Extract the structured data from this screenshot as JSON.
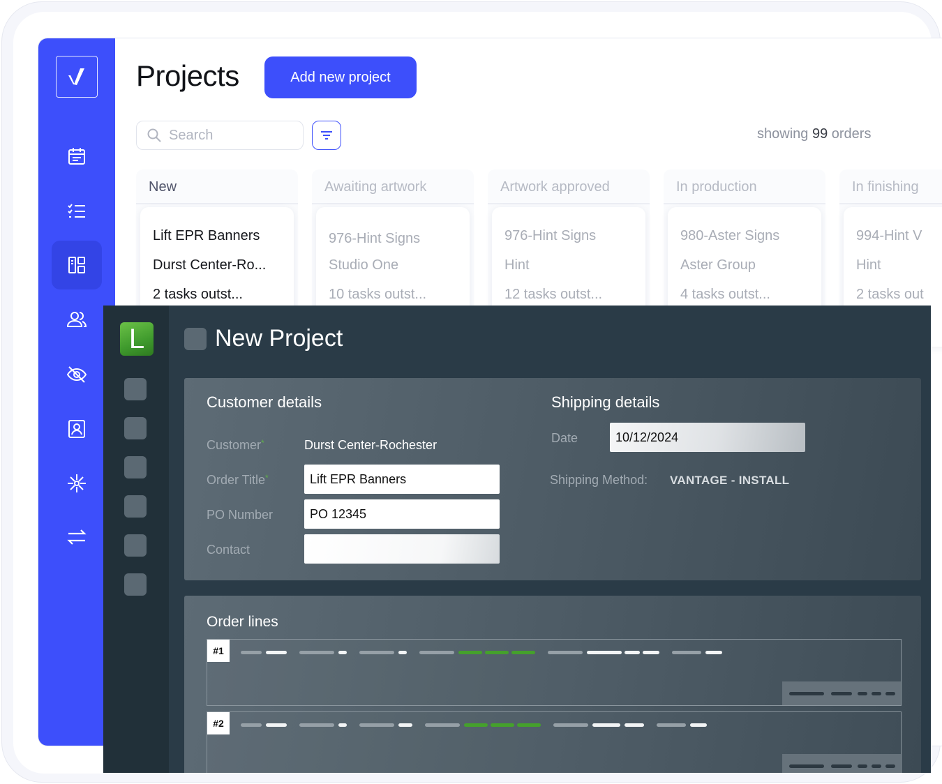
{
  "back_app": {
    "title": "Projects",
    "add_button": "Add new project",
    "search_placeholder": "Search",
    "showing_prefix": "showing",
    "showing_count": "99",
    "showing_suffix": "orders",
    "nav_icons": [
      "calendar-icon",
      "checklist-icon",
      "board-icon",
      "users-icon",
      "hidden-icon",
      "contact-card-icon",
      "snowflake-icon",
      "transfer-icon"
    ],
    "columns": [
      {
        "name": "New",
        "card": {
          "title": "Lift EPR Banners",
          "customer": "Durst Center-Ro...",
          "tasks": "2 tasks outst..."
        }
      },
      {
        "name": "Awaiting artwork",
        "card": {
          "title": "976-Hint Signs",
          "customer": "Studio One",
          "tasks": "10 tasks outst..."
        }
      },
      {
        "name": "Artwork approved",
        "card": {
          "title": "976-Hint Signs",
          "customer": "Hint",
          "tasks": "12 tasks outst..."
        }
      },
      {
        "name": "In production",
        "card": {
          "title": "980-Aster Signs",
          "customer": "Aster Group",
          "tasks": "4 tasks outst..."
        }
      },
      {
        "name": "In finishing",
        "card": {
          "title": "994-Hint V",
          "customer": "Hint",
          "tasks": "2 tasks out"
        }
      }
    ],
    "colors": {
      "brand": "#3d4ffb"
    }
  },
  "front_app": {
    "logo_letter": "L",
    "title": "New Project",
    "customer_details": {
      "heading": "Customer details",
      "customer_label": "Customer",
      "customer_value": "Durst Center-Rochester",
      "order_title_label": "Order Title",
      "order_title_value": "Lift EPR Banners",
      "po_label": "PO Number",
      "po_value": "PO 12345",
      "contact_label": "Contact",
      "contact_value": ""
    },
    "shipping_details": {
      "heading": "Shipping details",
      "date_label": "Date",
      "date_value": "10/12/2024",
      "method_label": "Shipping Method:",
      "method_value": "VANTAGE - INSTALL"
    },
    "order_lines": {
      "heading": "Order lines",
      "lines": [
        {
          "tag": "#1"
        },
        {
          "tag": "#2"
        }
      ]
    },
    "colors": {
      "accent": "#45a02c",
      "background": "#2a3b47"
    }
  }
}
